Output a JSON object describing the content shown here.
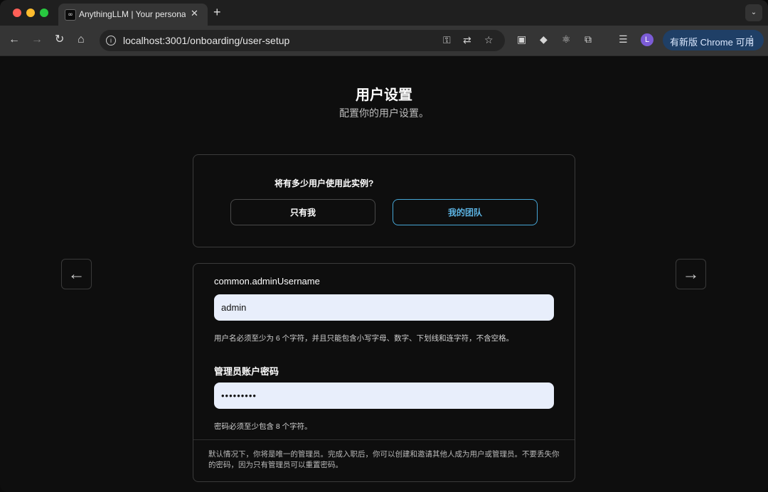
{
  "browser": {
    "tab_title": "AnythingLLM | Your personal",
    "tab_favicon": "∞",
    "url": "localhost:3001/onboarding/user-setup",
    "update_label": "有新版 Chrome 可用",
    "avatar_letter": "L"
  },
  "page": {
    "title": "用户设置",
    "subtitle": "配置你的用户设置。"
  },
  "user_count": {
    "question": "将有多少用户使用此实例?",
    "option_just_me": "只有我",
    "option_my_team": "我的团队",
    "selected": "option_my_team"
  },
  "form": {
    "username_label": "common.adminUsername",
    "username_value": "admin",
    "username_hint": "用户名必须至少为 6 个字符，并且只能包含小写字母、数字、下划线和连字符，不含空格。",
    "password_label": "管理员账户密码",
    "password_value": "•••••••••",
    "password_hint": "密码必须至少包含 8 个字符。",
    "footer_note": "默认情况下，你将是唯一的管理员。完成入职后，你可以创建和邀请其他人成为用户或管理员。不要丢失你的密码，因为只有管理员可以重置密码。"
  },
  "nav": {
    "back_icon": "←",
    "forward_icon": "→"
  },
  "colors": {
    "accent": "#46a6d6",
    "input_bg": "#e8eefb",
    "update_bg": "#1f3f66"
  }
}
